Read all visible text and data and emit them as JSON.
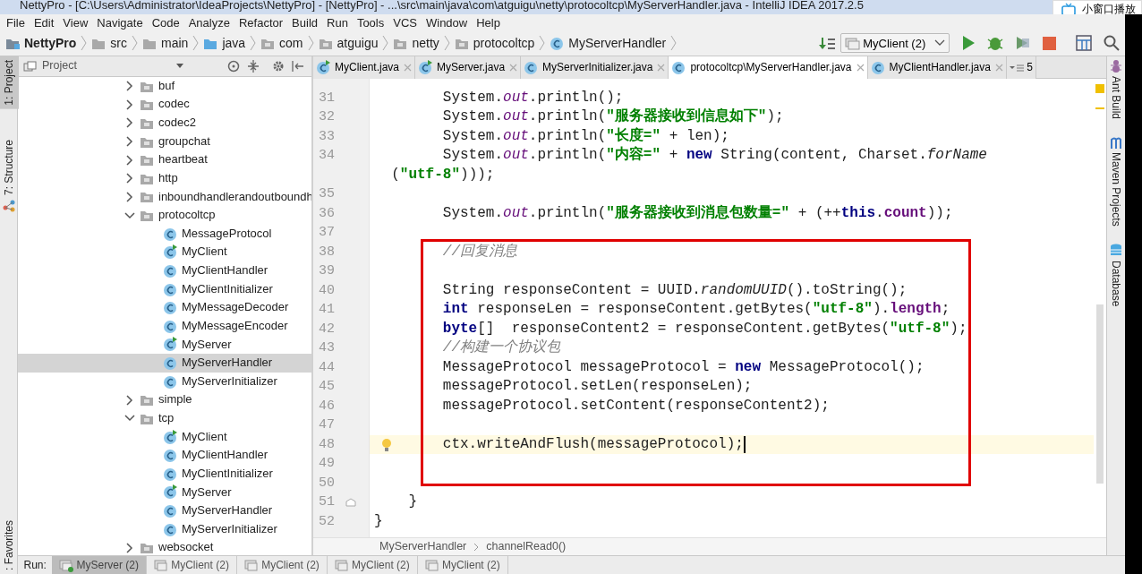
{
  "window": {
    "title": "NettyPro - [C:\\Users\\Administrator\\IdeaProjects\\NettyPro] - [NettyPro] - ...\\src\\main\\java\\com\\atguigu\\netty\\protocoltcp\\MyServerHandler.java - IntelliJ IDEA 2017.2.5"
  },
  "overlay_button": {
    "label": "小窗口播放"
  },
  "menu": [
    "File",
    "Edit",
    "View",
    "Navigate",
    "Code",
    "Analyze",
    "Refactor",
    "Build",
    "Run",
    "Tools",
    "VCS",
    "Window",
    "Help"
  ],
  "breadcrumbs": [
    {
      "label": "NettyPro",
      "kind": "module"
    },
    {
      "label": "src",
      "kind": "folder"
    },
    {
      "label": "main",
      "kind": "folder"
    },
    {
      "label": "java",
      "kind": "source"
    },
    {
      "label": "com",
      "kind": "package"
    },
    {
      "label": "atguigu",
      "kind": "package"
    },
    {
      "label": "netty",
      "kind": "package"
    },
    {
      "label": "protocoltcp",
      "kind": "package"
    },
    {
      "label": "MyServerHandler",
      "kind": "class"
    }
  ],
  "run_config": {
    "label": "MyClient (2)"
  },
  "left_stripe": [
    {
      "label": "1: Project",
      "selected": true
    },
    {
      "label": "7: Structure",
      "selected": false
    },
    {
      "label": ": Favorites",
      "selected": false
    }
  ],
  "project_panel": {
    "title": "Project",
    "tree": [
      {
        "label": "buf",
        "kind": "folder",
        "expanded": false,
        "selected": false
      },
      {
        "label": "codec",
        "kind": "folder",
        "expanded": false,
        "selected": false
      },
      {
        "label": "codec2",
        "kind": "folder",
        "expanded": false,
        "selected": false
      },
      {
        "label": "groupchat",
        "kind": "folder",
        "expanded": false,
        "selected": false
      },
      {
        "label": "heartbeat",
        "kind": "folder",
        "expanded": false,
        "selected": false
      },
      {
        "label": "http",
        "kind": "folder",
        "expanded": false,
        "selected": false
      },
      {
        "label": "inboundhandlerandoutboundh",
        "kind": "folder",
        "expanded": false,
        "selected": false
      },
      {
        "label": "protocoltcp",
        "kind": "folder",
        "expanded": true,
        "selected": false,
        "children": [
          {
            "label": "MessageProtocol",
            "kind": "class",
            "selected": false
          },
          {
            "label": "MyClient",
            "kind": "runnable",
            "selected": false
          },
          {
            "label": "MyClientHandler",
            "kind": "class",
            "selected": false
          },
          {
            "label": "MyClientInitializer",
            "kind": "class",
            "selected": false
          },
          {
            "label": "MyMessageDecoder",
            "kind": "class",
            "selected": false
          },
          {
            "label": "MyMessageEncoder",
            "kind": "class",
            "selected": false
          },
          {
            "label": "MyServer",
            "kind": "runnable",
            "selected": false
          },
          {
            "label": "MyServerHandler",
            "kind": "class",
            "selected": true
          },
          {
            "label": "MyServerInitializer",
            "kind": "class",
            "selected": false
          }
        ]
      },
      {
        "label": "simple",
        "kind": "folder",
        "expanded": false,
        "selected": false
      },
      {
        "label": "tcp",
        "kind": "folder",
        "expanded": true,
        "selected": false,
        "children": [
          {
            "label": "MyClient",
            "kind": "runnable",
            "selected": false
          },
          {
            "label": "MyClientHandler",
            "kind": "class",
            "selected": false
          },
          {
            "label": "MyClientInitializer",
            "kind": "class",
            "selected": false
          },
          {
            "label": "MyServer",
            "kind": "runnable",
            "selected": false
          },
          {
            "label": "MyServerHandler",
            "kind": "class",
            "selected": false
          },
          {
            "label": "MyServerInitializer",
            "kind": "class",
            "selected": false
          }
        ]
      },
      {
        "label": "websocket",
        "kind": "folder",
        "expanded": false,
        "selected": false
      }
    ]
  },
  "editor": {
    "tabs": [
      {
        "label": "MyClient.java",
        "kind": "runnable",
        "selected": false
      },
      {
        "label": "MyServer.java",
        "kind": "runnable",
        "selected": false
      },
      {
        "label": "MyServerInitializer.java",
        "kind": "class",
        "selected": false
      },
      {
        "label": "protocoltcp\\MyServerHandler.java",
        "kind": "class",
        "selected": true
      },
      {
        "label": "MyClientHandler.java",
        "kind": "class",
        "selected": false
      }
    ],
    "tabs_overflow": "5",
    "sections": [
      {
        "boxed": false,
        "lines": [
          {
            "n": "31",
            "kind": "statement",
            "current": false,
            "tokens": [
              {
                "text": "System.",
                "kind": "plain"
              },
              {
                "text": "out",
                "kind": "static-field"
              },
              {
                "text": ".println();",
                "kind": "plain"
              }
            ]
          },
          {
            "n": "32",
            "kind": "statement",
            "current": false,
            "tokens": [
              {
                "text": "System.",
                "kind": "plain"
              },
              {
                "text": "out",
                "kind": "static-field"
              },
              {
                "text": ".println(",
                "kind": "plain"
              },
              {
                "text": "\"服务器接收到信息如下\"",
                "kind": "string"
              },
              {
                "text": ");",
                "kind": "plain"
              }
            ]
          },
          {
            "n": "33",
            "kind": "statement",
            "current": false,
            "tokens": [
              {
                "text": "System.",
                "kind": "plain"
              },
              {
                "text": "out",
                "kind": "static-field"
              },
              {
                "text": ".println(",
                "kind": "plain"
              },
              {
                "text": "\"长度=\"",
                "kind": "string"
              },
              {
                "text": " + len);",
                "kind": "plain"
              }
            ]
          },
          {
            "n": "34",
            "kind": "statement",
            "current": false,
            "tokens": [
              {
                "text": "System.",
                "kind": "plain"
              },
              {
                "text": "out",
                "kind": "static-field"
              },
              {
                "text": ".println(",
                "kind": "plain"
              },
              {
                "text": "\"内容=\"",
                "kind": "string"
              },
              {
                "text": " + ",
                "kind": "plain"
              },
              {
                "text": "new",
                "kind": "keyword"
              },
              {
                "text": " String(content, Charset.",
                "kind": "plain"
              },
              {
                "text": "forName",
                "kind": "static-method"
              }
            ],
            "cont": [
              {
                "text": "(",
                "kind": "plain"
              },
              {
                "text": "\"utf-8\"",
                "kind": "string"
              },
              {
                "text": ")));",
                "kind": "plain"
              }
            ]
          },
          {
            "n": "35",
            "kind": "blank",
            "current": false
          },
          {
            "n": "36",
            "kind": "statement",
            "current": false,
            "tokens": [
              {
                "text": "System.",
                "kind": "plain"
              },
              {
                "text": "out",
                "kind": "static-field"
              },
              {
                "text": ".println(",
                "kind": "plain"
              },
              {
                "text": "\"服务器接收到消息包数量=\"",
                "kind": "string"
              },
              {
                "text": " + (++",
                "kind": "plain"
              },
              {
                "text": "this",
                "kind": "keyword"
              },
              {
                "text": ".",
                "kind": "plain"
              },
              {
                "text": "count",
                "kind": "field"
              },
              {
                "text": "));",
                "kind": "plain"
              }
            ]
          },
          {
            "n": "37",
            "kind": "blank",
            "current": false
          }
        ]
      },
      {
        "boxed": true,
        "lines": [
          {
            "n": "38",
            "kind": "statement",
            "current": false,
            "tokens": [
              {
                "text": "//回复消息",
                "kind": "comment"
              }
            ]
          },
          {
            "n": "39",
            "kind": "blank",
            "current": false
          },
          {
            "n": "40",
            "kind": "statement",
            "current": false,
            "tokens": [
              {
                "text": "String responseContent = UUID.",
                "kind": "plain"
              },
              {
                "text": "randomUUID",
                "kind": "static-method"
              },
              {
                "text": "().toString();",
                "kind": "plain"
              }
            ]
          },
          {
            "n": "41",
            "kind": "statement",
            "current": false,
            "tokens": [
              {
                "text": "int",
                "kind": "keyword"
              },
              {
                "text": " responseLen = responseContent.getBytes(",
                "kind": "plain"
              },
              {
                "text": "\"utf-8\"",
                "kind": "string"
              },
              {
                "text": ").",
                "kind": "plain"
              },
              {
                "text": "length",
                "kind": "field"
              },
              {
                "text": ";",
                "kind": "plain"
              }
            ]
          },
          {
            "n": "42",
            "kind": "statement",
            "current": false,
            "tokens": [
              {
                "text": "byte",
                "kind": "keyword"
              },
              {
                "text": "[]  responseContent2 = responseContent.getBytes(",
                "kind": "plain"
              },
              {
                "text": "\"utf-8\"",
                "kind": "string"
              },
              {
                "text": ");",
                "kind": "plain"
              }
            ]
          },
          {
            "n": "43",
            "kind": "statement",
            "current": false,
            "tokens": [
              {
                "text": "//构建一个协议包",
                "kind": "comment"
              }
            ]
          },
          {
            "n": "44",
            "kind": "statement",
            "current": false,
            "tokens": [
              {
                "text": "MessageProtocol messageProtocol = ",
                "kind": "plain"
              },
              {
                "text": "new",
                "kind": "keyword"
              },
              {
                "text": " MessageProtocol();",
                "kind": "plain"
              }
            ]
          },
          {
            "n": "45",
            "kind": "statement",
            "current": false,
            "tokens": [
              {
                "text": "messageProtocol.setLen(responseLen);",
                "kind": "plain"
              }
            ]
          },
          {
            "n": "46",
            "kind": "statement",
            "current": false,
            "tokens": [
              {
                "text": "messageProtocol.setContent(responseContent2);",
                "kind": "plain"
              }
            ]
          },
          {
            "n": "47",
            "kind": "blank",
            "current": false
          },
          {
            "n": "48",
            "kind": "statement",
            "current": true,
            "tokens": [
              {
                "text": "ctx.writeAndFlush(messageProtocol);",
                "kind": "plain"
              }
            ]
          },
          {
            "n": "49",
            "kind": "blank",
            "current": false
          }
        ]
      },
      {
        "boxed": false,
        "lines": [
          {
            "n": "50",
            "kind": "blank",
            "current": false
          },
          {
            "n": "51",
            "kind": "block-end",
            "current": false,
            "tokens": [
              {
                "text": "}",
                "kind": "plain"
              }
            ]
          },
          {
            "n": "52",
            "kind": "class-end",
            "current": false,
            "tokens": [
              {
                "text": "}",
                "kind": "plain"
              }
            ]
          }
        ]
      }
    ],
    "breadcrumb": [
      "MyServerHandler",
      "channelRead0()"
    ]
  },
  "right_stripe": [
    {
      "label": "Ant Build",
      "kind": "ant"
    },
    {
      "label": "Maven Projects",
      "kind": "maven"
    },
    {
      "label": "Database",
      "kind": "database"
    }
  ],
  "run_bar": {
    "label": "Run:",
    "tabs": [
      {
        "label": "MyServer (2)",
        "selected": true
      },
      {
        "label": "MyClient (2)",
        "selected": false
      },
      {
        "label": "MyClient (2)",
        "selected": false
      },
      {
        "label": "MyClient (2)",
        "selected": false
      },
      {
        "label": "MyClient (2)",
        "selected": false
      }
    ]
  }
}
